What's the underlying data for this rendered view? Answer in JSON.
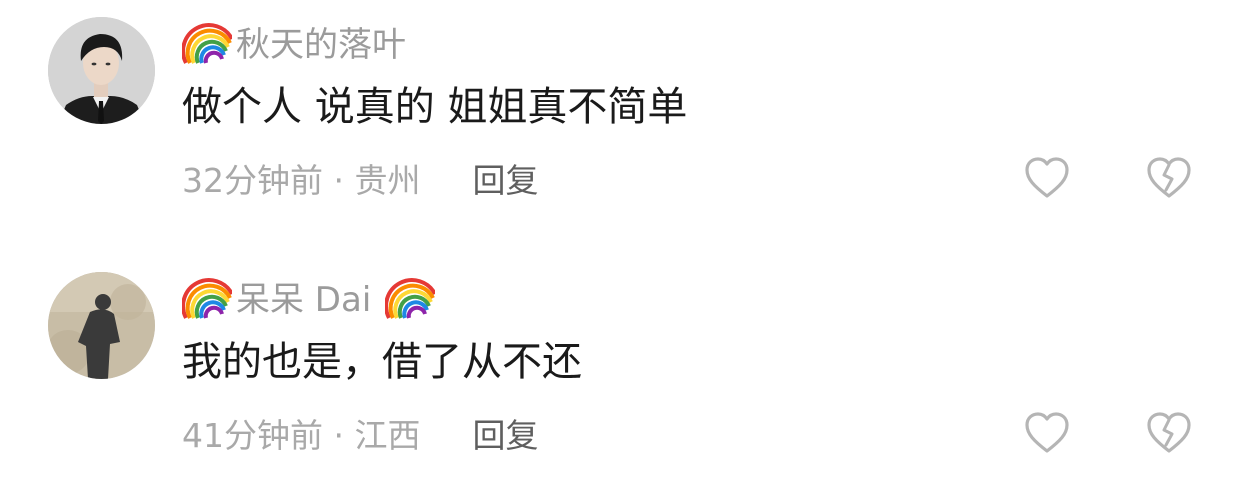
{
  "comments": [
    {
      "avatar_icon": "portrait-man-in-suit",
      "name_prefix_icon": "rainbow-icon",
      "username": "秋天的落叶",
      "text": "做个人 说真的 姐姐真不简单",
      "time_location": "32分钟前 · 贵州",
      "reply_label": "回复"
    },
    {
      "avatar_icon": "shadow-silhouette",
      "name_prefix_icon": "rainbow-icon",
      "name_suffix_icon": "rainbow-icon",
      "username": "呆呆 Dai",
      "text": "我的也是，借了从不还",
      "time_location": "41分钟前 · 江西",
      "reply_label": "回复"
    }
  ],
  "colors": {
    "username": "#9b9b9b",
    "comment_text": "#1a1a1a",
    "meta": "#a9a9a9",
    "reply": "#5f5f5f",
    "icon_stroke": "#b5b5b5"
  }
}
